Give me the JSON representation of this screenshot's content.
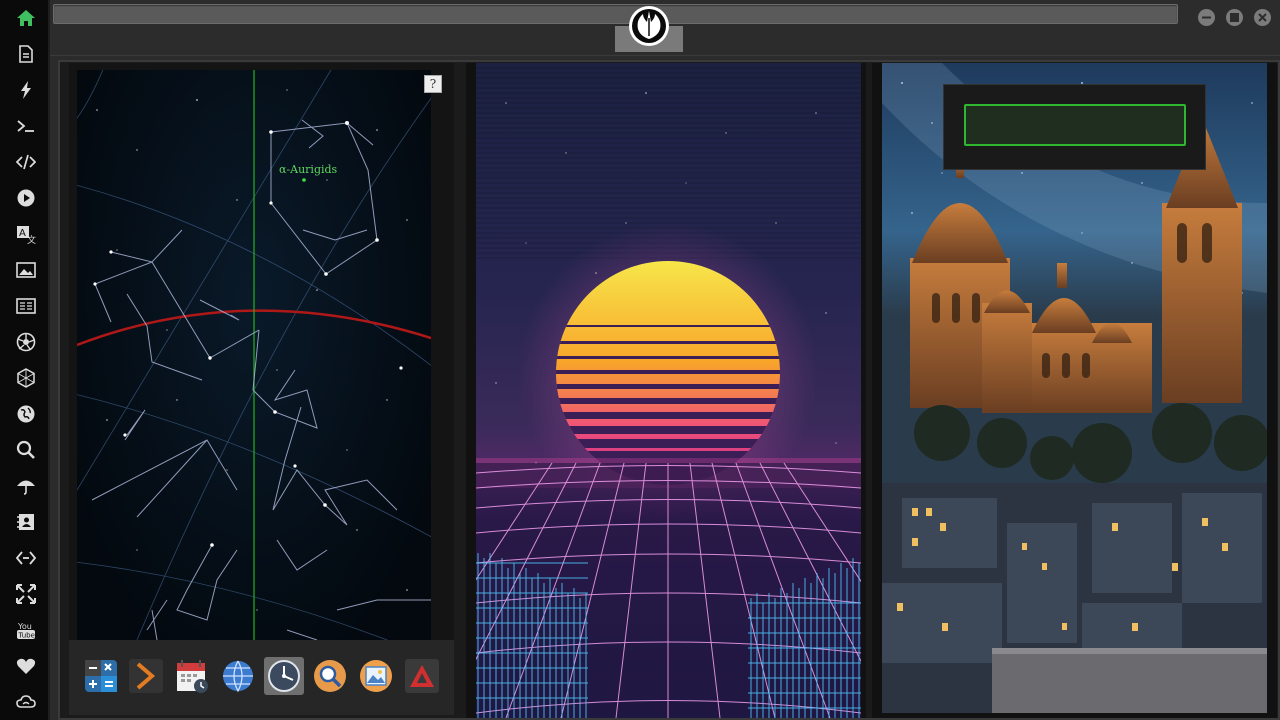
{
  "sidebar": {
    "items": [
      {
        "name": "home-icon",
        "glyph": "home",
        "color": "#3fbf5f"
      },
      {
        "name": "document-icon",
        "glyph": "doc"
      },
      {
        "name": "lightning-icon",
        "glyph": "bolt"
      },
      {
        "name": "terminal-icon",
        "glyph": "term"
      },
      {
        "name": "code-icon",
        "glyph": "code"
      },
      {
        "name": "play-icon",
        "glyph": "play"
      },
      {
        "name": "translate-icon",
        "glyph": "lang"
      },
      {
        "name": "image-icon",
        "glyph": "img"
      },
      {
        "name": "news-icon",
        "glyph": "news"
      },
      {
        "name": "aperture-icon",
        "glyph": "aper"
      },
      {
        "name": "hexagon-icon",
        "glyph": "hex"
      },
      {
        "name": "globe-icon",
        "glyph": "globe"
      },
      {
        "name": "search-icon",
        "glyph": "search"
      },
      {
        "name": "umbrella-icon",
        "glyph": "umb"
      },
      {
        "name": "contact-book-icon",
        "glyph": "contact"
      },
      {
        "name": "network-icon",
        "glyph": "net"
      },
      {
        "name": "fullscreen-icon",
        "glyph": "full"
      },
      {
        "name": "youtube-icon",
        "glyph": "yt"
      },
      {
        "name": "heart-icon",
        "glyph": "heart"
      },
      {
        "name": "cloud-icon",
        "glyph": "cloud"
      }
    ]
  },
  "colors": {
    "accent": "#3fbf5f",
    "red_arc": "#b01818",
    "meridian": "#1fa81f"
  },
  "starmap": {
    "constellation_label": "α-Aurigids",
    "help_label": "?"
  },
  "dock": {
    "apps": [
      {
        "name": "calculator-icon"
      },
      {
        "name": "terminal-arrow-icon"
      },
      {
        "name": "calendar-icon"
      },
      {
        "name": "browser-globe-icon"
      },
      {
        "name": "clock-icon"
      },
      {
        "name": "magnifier-icon"
      },
      {
        "name": "photos-icon"
      },
      {
        "name": "alert-icon"
      }
    ]
  },
  "login": {
    "value": ""
  }
}
